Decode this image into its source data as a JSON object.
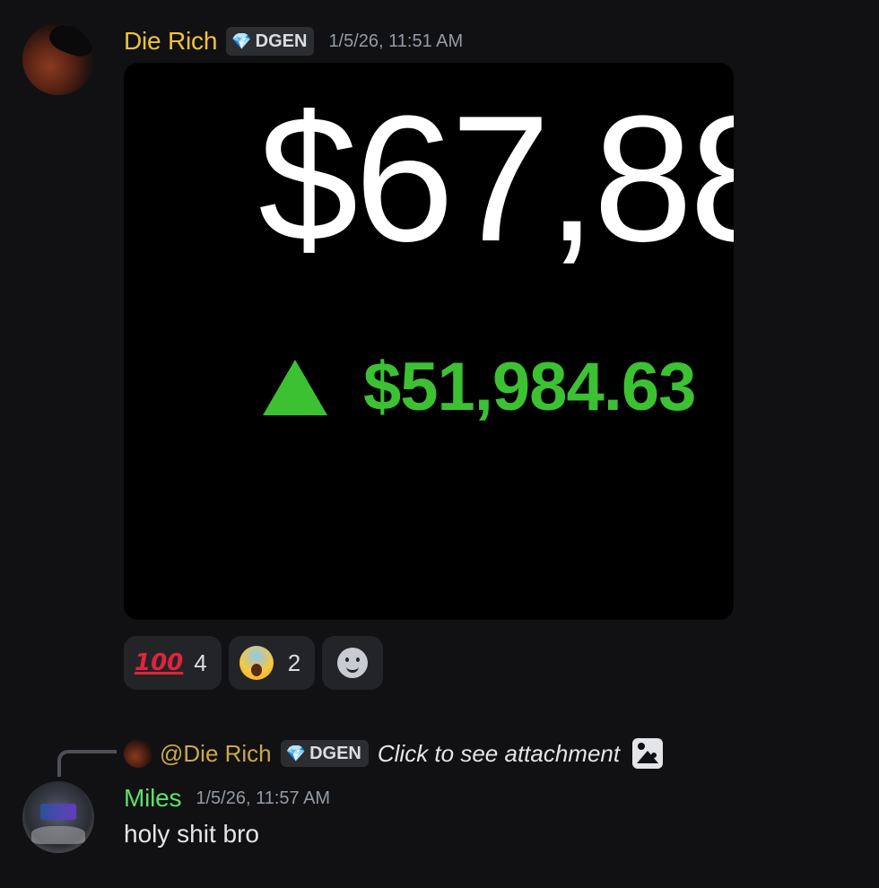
{
  "messages": [
    {
      "username": "Die Rich",
      "username_color": "#f0c23a",
      "tag": {
        "icon": "gem-icon",
        "label": "DGEN"
      },
      "timestamp": "1/5/26, 11:51 AM",
      "attachment": {
        "price_text": "$67,88",
        "change_arrow": "up-triangle-icon",
        "change_text": "$51,984.63",
        "change_color": "#3cc132"
      },
      "reactions": [
        {
          "emoji": "💯",
          "icon": "hundred-points-icon",
          "count": "4"
        },
        {
          "emoji": "😱",
          "icon": "face-screaming-icon",
          "count": "2"
        },
        {
          "icon": "add-reaction-icon"
        }
      ]
    },
    {
      "reply": {
        "mention": "@Die Rich",
        "tag": {
          "icon": "gem-icon",
          "label": "DGEN"
        },
        "text": "Click to see attachment",
        "icon": "image-attachment-icon"
      },
      "username": "Miles",
      "username_color": "#5ee06a",
      "timestamp": "1/5/26, 11:57 AM",
      "content": "holy shit bro"
    }
  ]
}
